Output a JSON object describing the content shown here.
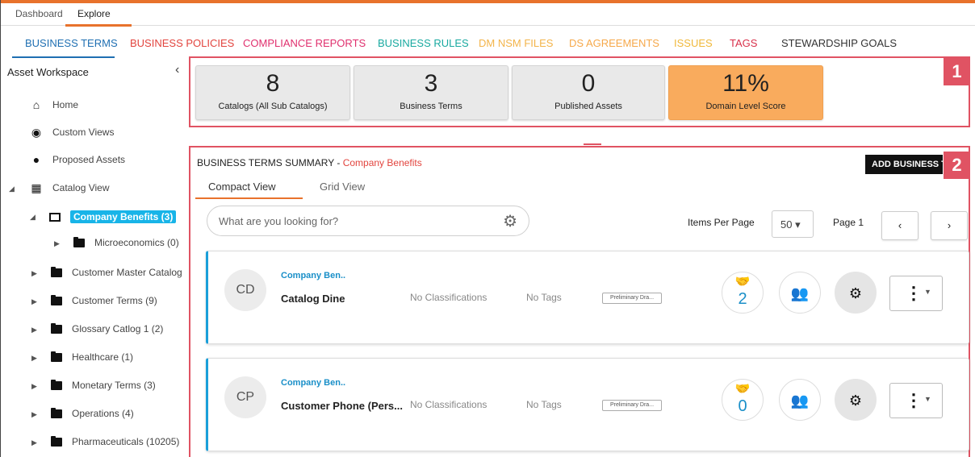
{
  "top_nav": {
    "dashboard": "Dashboard",
    "explore": "Explore"
  },
  "sub_tabs": [
    {
      "label": "BUSINESS TERMS",
      "color": "#1f6fb2"
    },
    {
      "label": "BUSINESS POLICIES",
      "color": "#e2443e"
    },
    {
      "label": "COMPLIANCE REPORTS",
      "color": "#e0306e"
    },
    {
      "label": "BUSINESS RULES",
      "color": "#19a9a0"
    },
    {
      "label": "DM NSM FILES",
      "color": "#f3b44a"
    },
    {
      "label": "DS AGREEMENTS",
      "color": "#f6a84a"
    },
    {
      "label": "ISSUES",
      "color": "#f0b83a"
    },
    {
      "label": "TAGS",
      "color": "#d8304a"
    },
    {
      "label": "STEWARDSHIP GOALS",
      "color": "#333333"
    }
  ],
  "sidebar": {
    "title": "Asset Workspace",
    "collapse": "‹",
    "items": [
      {
        "label": "Home",
        "icon": "home-icon"
      },
      {
        "label": "Custom Views",
        "icon": "eye-icon"
      },
      {
        "label": "Proposed Assets",
        "icon": "lightbulb-icon"
      },
      {
        "label": "Catalog View",
        "icon": "grid-icon"
      }
    ],
    "tree": {
      "selected": "Company Benefits (3)",
      "child": "Microeconomics (0)",
      "catalogs": [
        "Customer Master Catalog",
        "Customer Terms (9)",
        "Glossary Catlog 1 (2)",
        "Healthcare (1)",
        "Monetary Terms (3)",
        "Operations (4)",
        "Pharmaceuticals (10205)"
      ]
    }
  },
  "stats": [
    {
      "value": "8",
      "label": "Catalogs (All Sub Catalogs)"
    },
    {
      "value": "3",
      "label": "Business Terms"
    },
    {
      "value": "0",
      "label": "Published Assets"
    },
    {
      "value": "11%",
      "label": "Domain Level Score"
    }
  ],
  "callouts": {
    "one": "1",
    "two": "2"
  },
  "summary": {
    "title_prefix": "BUSINESS TERMS SUMMARY - ",
    "title_accent": "Company Benefits",
    "add_button": "ADD BUSINESS T",
    "views": {
      "compact": "Compact View",
      "grid": "Grid View"
    },
    "search_placeholder": "What are you looking for?",
    "items_per_page_label": "Items Per Page",
    "items_per_page_value": "50 ▾",
    "page_label": "Page 1",
    "prev": "‹",
    "next": "›"
  },
  "rows": [
    {
      "initials": "CD",
      "catalog": "Company Ben..",
      "name": "Catalog Dine",
      "classifications": "No Classifications",
      "tags": "No Tags",
      "status": "Preliminary Dra...",
      "stakeholders": "2"
    },
    {
      "initials": "CP",
      "catalog": "Company Ben..",
      "name": "Customer Phone (Pers...",
      "classifications": "No Classifications",
      "tags": "No Tags",
      "status": "Preliminary Dra...",
      "stakeholders": "0"
    }
  ]
}
